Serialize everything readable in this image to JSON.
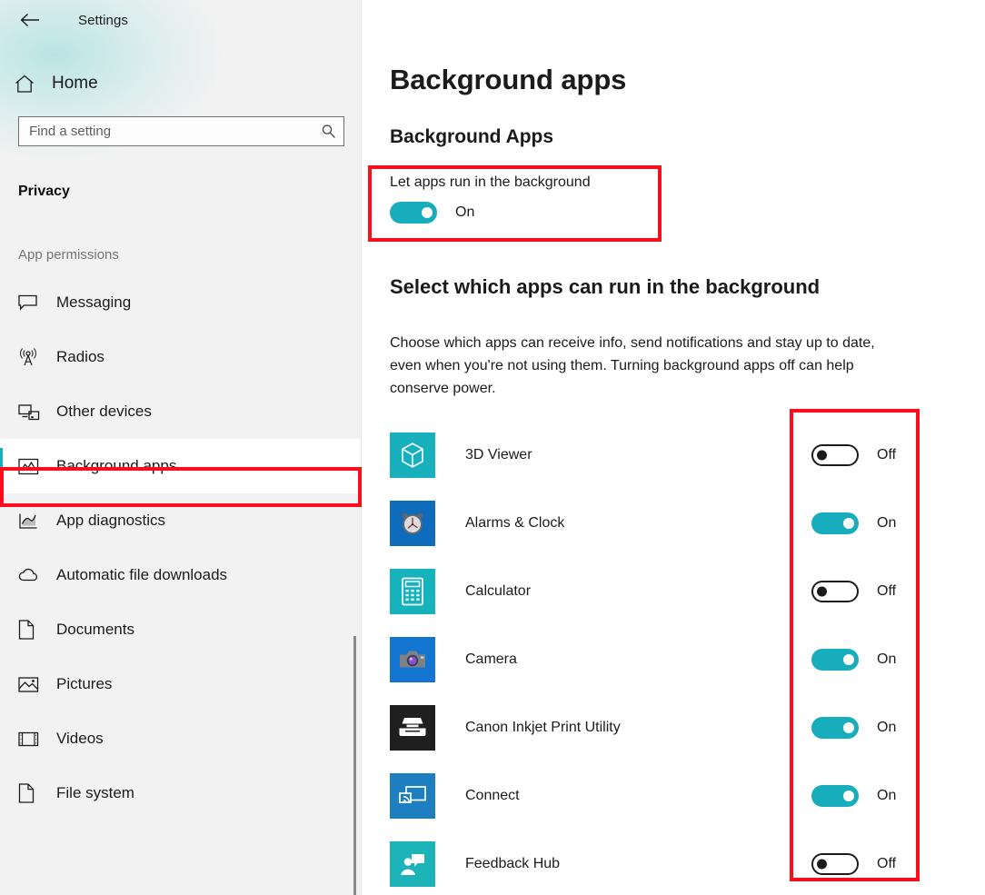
{
  "window": {
    "back_label": "Back",
    "title": "Settings"
  },
  "sidebar": {
    "home_label": "Home",
    "search": {
      "placeholder": "Find a setting",
      "value": "",
      "icon": "search-icon"
    },
    "category_heading": "Privacy",
    "group_label": "App permissions",
    "items": [
      {
        "label": "Messaging",
        "icon": "message-bubble-icon",
        "selected": false
      },
      {
        "label": "Radios",
        "icon": "radio-tower-icon",
        "selected": false
      },
      {
        "label": "Other devices",
        "icon": "devices-icon",
        "selected": false
      },
      {
        "label": "Background apps",
        "icon": "chart-window-icon",
        "selected": true
      },
      {
        "label": "App diagnostics",
        "icon": "diagnostics-icon",
        "selected": false
      },
      {
        "label": "Automatic file downloads",
        "icon": "cloud-icon",
        "selected": false
      },
      {
        "label": "Documents",
        "icon": "document-icon",
        "selected": false
      },
      {
        "label": "Pictures",
        "icon": "picture-icon",
        "selected": false
      },
      {
        "label": "Videos",
        "icon": "video-icon",
        "selected": false
      },
      {
        "label": "File system",
        "icon": "document-icon",
        "selected": false
      }
    ]
  },
  "main": {
    "page_title": "Background apps",
    "section_title": "Background Apps",
    "master_toggle": {
      "label": "Let apps run in the background",
      "state": "On",
      "on": true
    },
    "select_heading": "Select which apps can run in the background",
    "select_description": "Choose which apps can receive info, send notifications and stay up to date, even when you're not using them. Turning background apps off can help conserve power.",
    "apps": [
      {
        "name": "3D Viewer",
        "icon": "cube-icon",
        "icon_bg": "#17b0bc",
        "state": "Off",
        "on": false
      },
      {
        "name": "Alarms & Clock",
        "icon": "alarm-clock-icon",
        "icon_bg": "#0f6cbd",
        "state": "On",
        "on": true
      },
      {
        "name": "Calculator",
        "icon": "calculator-icon",
        "icon_bg": "#17b3bc",
        "state": "Off",
        "on": false
      },
      {
        "name": "Camera",
        "icon": "camera-icon",
        "icon_bg": "#1475d1",
        "state": "On",
        "on": true
      },
      {
        "name": "Canon Inkjet Print Utility",
        "icon": "printer-icon",
        "icon_bg": "#1f1f1f",
        "state": "On",
        "on": true
      },
      {
        "name": "Connect",
        "icon": "cast-screen-icon",
        "icon_bg": "#1d7fc0",
        "state": "On",
        "on": true
      },
      {
        "name": "Feedback Hub",
        "icon": "feedback-person-icon",
        "icon_bg": "#1cb3b8",
        "state": "Off",
        "on": false
      }
    ]
  },
  "annotations": {
    "highlight_color": "#fc0d1b",
    "boxes": [
      {
        "name": "master-toggle-highlight"
      },
      {
        "name": "background-apps-nav-highlight"
      },
      {
        "name": "per-app-toggles-highlight"
      }
    ]
  },
  "theme": {
    "accent": "#17adbc",
    "sidebar_bg": "#f2f2f2",
    "content_bg": "#ffffff",
    "text": "#1b1b1b"
  }
}
